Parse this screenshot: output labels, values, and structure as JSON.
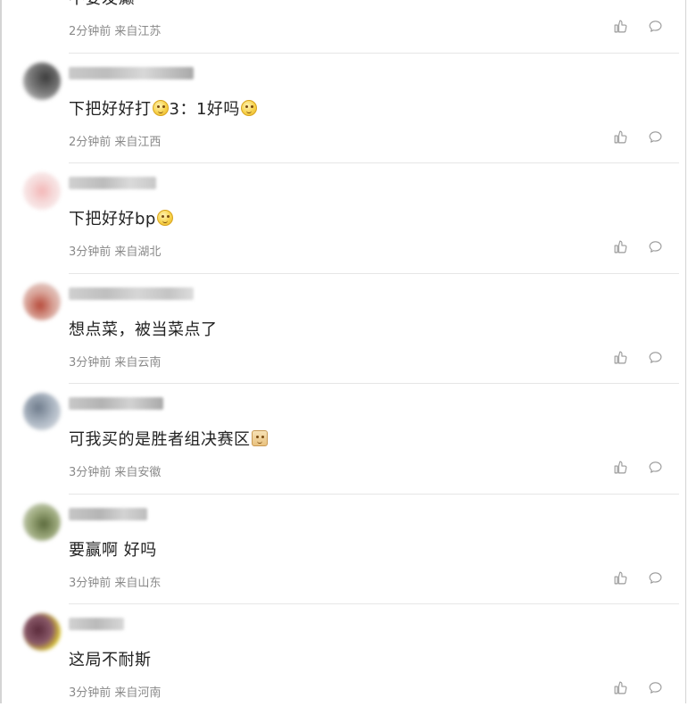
{
  "comments": [
    {
      "text": "不要发癫",
      "meta": "2分钟前 来自江苏"
    },
    {
      "text_parts": [
        "下把好好打",
        "3：1好吗",
        ""
      ],
      "meta": "2分钟前 来自江西"
    },
    {
      "text_parts": [
        "下把好好bp"
      ],
      "meta": "3分钟前 来自湖北"
    },
    {
      "text": "想点菜，被当菜点了",
      "meta": "3分钟前 来自云南"
    },
    {
      "text": "可我买的是胜者组决赛区",
      "meta": "3分钟前 来自安徽"
    },
    {
      "text": "要赢啊 好吗",
      "meta": "3分钟前 来自山东"
    },
    {
      "text": "这局不耐斯",
      "meta": "3分钟前 来自河南"
    }
  ],
  "icons": {
    "like": "thumbs-up-icon",
    "reply": "comment-bubble-icon"
  },
  "colors": {
    "text": "#222222",
    "meta": "#8a8a8a",
    "divider": "#e6e6e6",
    "icon": "#9a9a9a"
  }
}
